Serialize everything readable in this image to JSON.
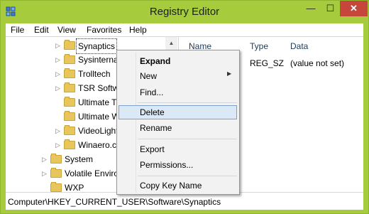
{
  "window": {
    "title": "Registry Editor"
  },
  "titlebar": {
    "minimize": "—",
    "maximize": "☐",
    "close": "✕"
  },
  "menubar": {
    "items": [
      "File",
      "Edit",
      "View",
      "Favorites",
      "Help"
    ]
  },
  "tree": {
    "items": [
      {
        "label": "Synaptics"
      },
      {
        "label": "Sysinternals"
      },
      {
        "label": "Trolltech"
      },
      {
        "label": "TSR Software"
      },
      {
        "label": "Ultimate Theme Patcher"
      },
      {
        "label": "Ultimate Windows Tweaker"
      },
      {
        "label": "VideoLightbox"
      },
      {
        "label": "Winaero.com"
      },
      {
        "label": "System"
      },
      {
        "label": "Volatile Environment"
      },
      {
        "label": "WXP"
      }
    ],
    "scroll_up": "▲",
    "scroll_down": "▼"
  },
  "list": {
    "headers": {
      "name": "Name",
      "type": "Type",
      "data": "Data"
    },
    "rows": [
      {
        "type": "REG_SZ",
        "data": "(value not set)"
      }
    ]
  },
  "context_menu": {
    "items": [
      {
        "label": "Expand"
      },
      {
        "label": "New"
      },
      {
        "label": "Find..."
      },
      {
        "label": "Delete"
      },
      {
        "label": "Rename"
      },
      {
        "label": "Export"
      },
      {
        "label": "Permissions..."
      },
      {
        "label": "Copy Key Name"
      }
    ],
    "submenu_arrow": "▶"
  },
  "statusbar": {
    "path": "Computer\\HKEY_CURRENT_USER\\Software\\Synaptics"
  },
  "colors": {
    "accent": "#a6cc3d",
    "close": "#c7463c",
    "highlight": "#dbe8f6"
  }
}
